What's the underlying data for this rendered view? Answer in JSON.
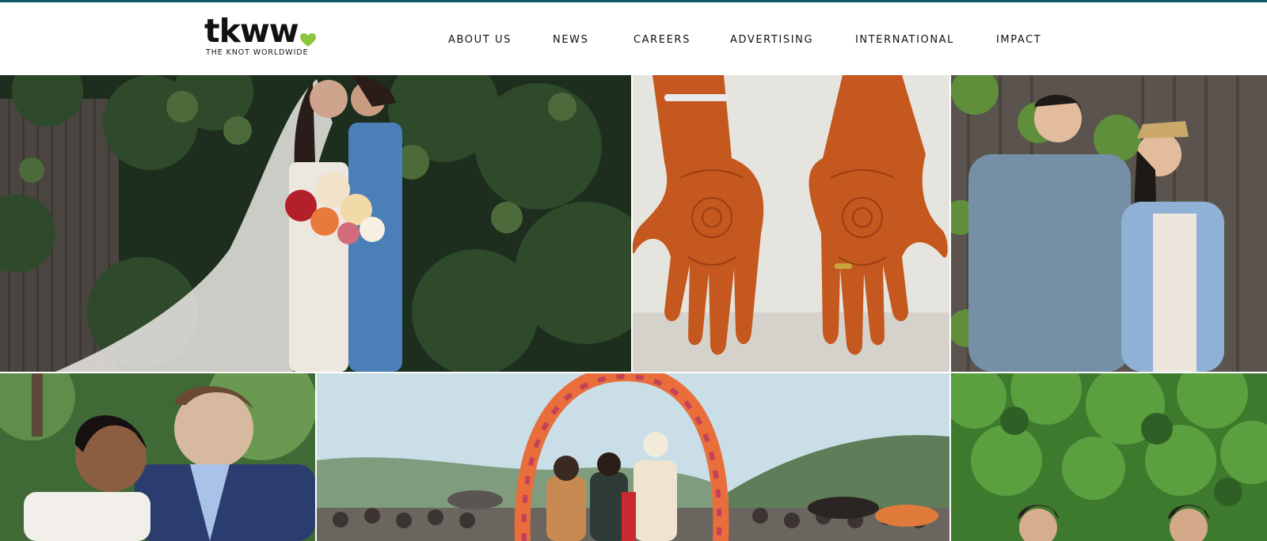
{
  "brand": {
    "logo_word": "tkww",
    "logo_tagline": "THE KNOT WORLDWIDE",
    "heart_color": "#8cc63f",
    "accent_color": "#0e5a66"
  },
  "nav": {
    "items": [
      {
        "label": "ABOUT US"
      },
      {
        "label": "NEWS"
      },
      {
        "label": "CAREERS"
      },
      {
        "label": "ADVERTISING"
      },
      {
        "label": "INTERNATIONAL"
      },
      {
        "label": "IMPACT"
      }
    ]
  },
  "gallery": {
    "photos": [
      {
        "subject": "couple-veil-ivy"
      },
      {
        "subject": "henna-hands"
      },
      {
        "subject": "couple-fence"
      },
      {
        "subject": "couple-portrait"
      },
      {
        "subject": "ceremony-floral-arch"
      },
      {
        "subject": "grooms-greenery"
      }
    ]
  }
}
